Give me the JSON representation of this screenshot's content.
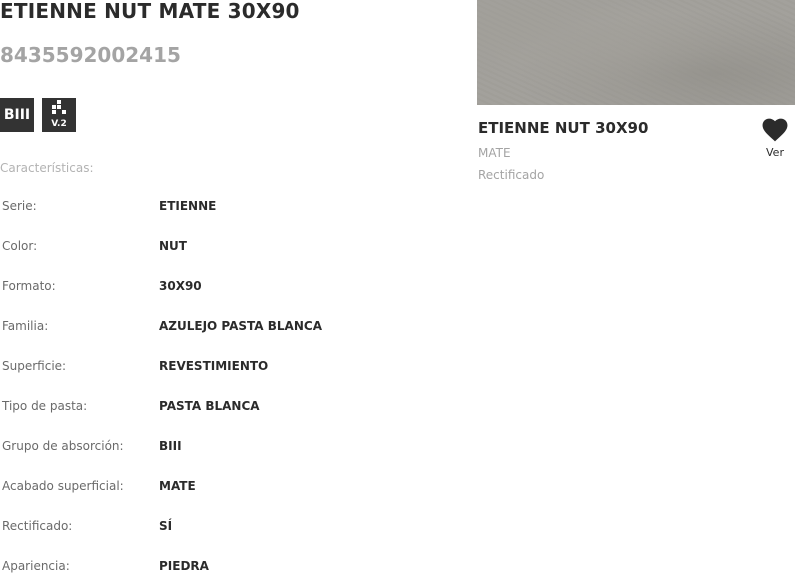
{
  "product": {
    "title": "ETIENNE NUT MATE 30X90",
    "ean": "8435592002415",
    "badges": {
      "absorption": "BIII",
      "version": "V.2",
      "version_icon": "grid-dots-icon"
    }
  },
  "characteristics": {
    "label": "Características:",
    "rows": [
      {
        "key": "Serie:",
        "value": "ETIENNE"
      },
      {
        "key": "Color:",
        "value": "NUT"
      },
      {
        "key": "Formato:",
        "value": "30X90"
      },
      {
        "key": "Familia:",
        "value": "AZULEJO PASTA BLANCA"
      },
      {
        "key": "Superficie:",
        "value": "REVESTIMIENTO"
      },
      {
        "key": "Tipo de pasta:",
        "value": "PASTA BLANCA"
      },
      {
        "key": "Grupo de absorción:",
        "value": "BIII"
      },
      {
        "key": "Acabado superficial:",
        "value": "MATE"
      },
      {
        "key": "Rectificado:",
        "value": "SÍ"
      },
      {
        "key": "Apariencia:",
        "value": "PIEDRA"
      }
    ]
  },
  "card": {
    "title": "ETIENNE NUT 30X90",
    "finish": "MATE",
    "edge": "Rectificado",
    "favorite_label": "Ver",
    "favorite_icon": "heart-icon",
    "image_color": "#a3a19c"
  },
  "colors": {
    "text_dark": "#2b2b2b",
    "text_muted": "#a4a4a4",
    "badge_bg": "#333333"
  }
}
